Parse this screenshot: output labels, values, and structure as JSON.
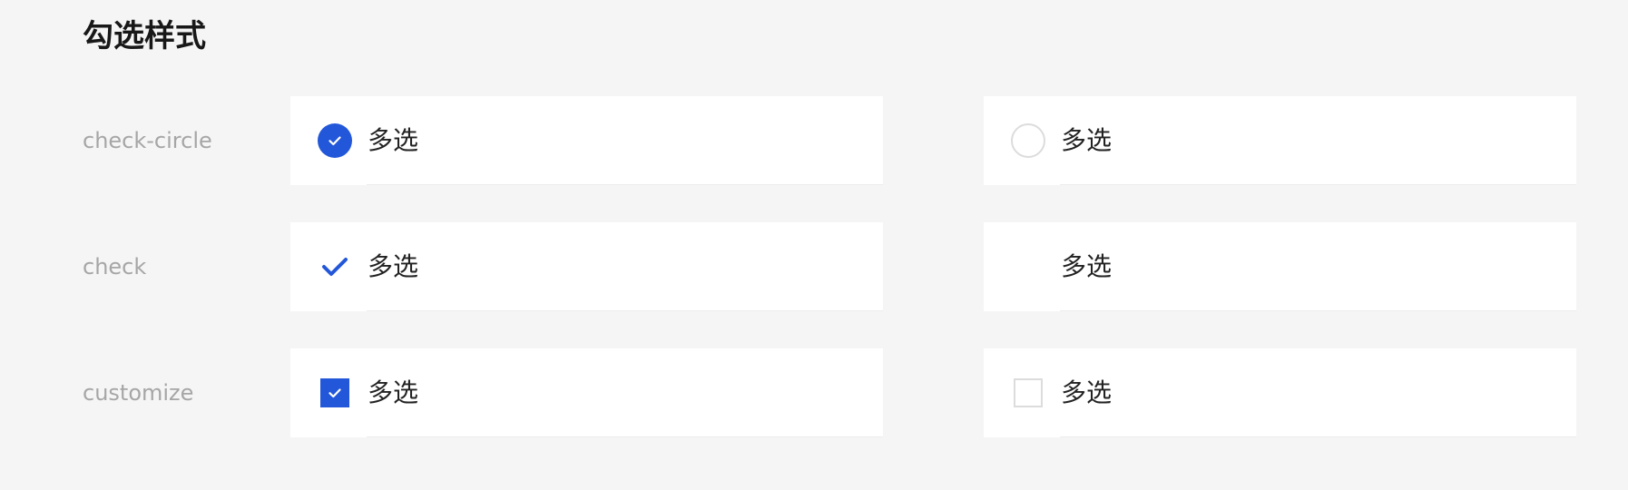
{
  "title": "勾选样式",
  "colors": {
    "accent": "#2357d9",
    "background": "#f5f5f5",
    "cell_background": "#ffffff",
    "muted_label": "#a6a6a6",
    "unchecked_border": "#dcdcdc"
  },
  "rows": [
    {
      "label": "check-circle",
      "checked": {
        "text": "多选",
        "icon": "check-circle-filled-icon",
        "state": "checked"
      },
      "unchecked": {
        "text": "多选",
        "icon": "circle-outline-icon",
        "state": "unchecked"
      }
    },
    {
      "label": "check",
      "checked": {
        "text": "多选",
        "icon": "check-mark-icon",
        "state": "checked"
      },
      "unchecked": {
        "text": "多选",
        "icon": "none",
        "state": "unchecked"
      }
    },
    {
      "label": "customize",
      "checked": {
        "text": "多选",
        "icon": "check-square-filled-icon",
        "state": "checked"
      },
      "unchecked": {
        "text": "多选",
        "icon": "square-outline-icon",
        "state": "unchecked"
      }
    }
  ]
}
